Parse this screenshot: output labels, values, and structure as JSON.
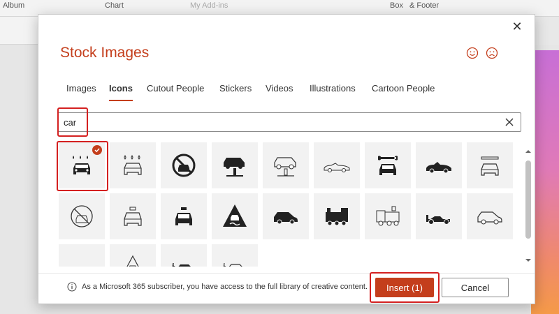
{
  "ribbon": {
    "album_label": "Album",
    "chart_label": "Chart",
    "addins_label": "My Add-ins",
    "box_label": "Box",
    "footer_label": "& Footer"
  },
  "dialog": {
    "title": "Stock Images",
    "close_glyph": "✕"
  },
  "tabs": [
    {
      "label": "Images"
    },
    {
      "label": "Icons",
      "active": true
    },
    {
      "label": "Cutout People"
    },
    {
      "label": "Stickers"
    },
    {
      "label": "Videos"
    },
    {
      "label": "Illustrations"
    },
    {
      "label": "Cartoon People"
    }
  ],
  "search": {
    "value": "car",
    "clear_icon": "clear-search-icon"
  },
  "icons": [
    {
      "name": "car-wash-icon",
      "selected": true
    },
    {
      "name": "car-wash-outline-icon"
    },
    {
      "name": "no-car-icon"
    },
    {
      "name": "car-lift-icon"
    },
    {
      "name": "car-lift-outline-icon"
    },
    {
      "name": "convertible-outline-icon"
    },
    {
      "name": "car-repair-icon"
    },
    {
      "name": "convertible-car-icon"
    },
    {
      "name": "car-repair-outline-icon"
    },
    {
      "name": "no-car-outline-icon"
    },
    {
      "name": "taxi-outline-icon"
    },
    {
      "name": "taxi-icon"
    },
    {
      "name": "slippery-road-sign-icon"
    },
    {
      "name": "hatchback-car-icon"
    },
    {
      "name": "locomotive-icon"
    },
    {
      "name": "locomotive-outline-icon"
    },
    {
      "name": "race-car-icon"
    },
    {
      "name": "hatchback-outline-icon"
    },
    {
      "name": "race-car-outline-icon"
    },
    {
      "name": "slippery-road-outline-icon"
    },
    {
      "name": "electric-car-icon"
    },
    {
      "name": "electric-car-outline-icon"
    }
  ],
  "footer": {
    "info_text": "As a Microsoft 365 subscriber, you have access to the full library of creative content.",
    "insert_label": "Insert (1)",
    "cancel_label": "Cancel"
  },
  "colors": {
    "accent": "#c43e1c",
    "highlight": "#d42020"
  }
}
